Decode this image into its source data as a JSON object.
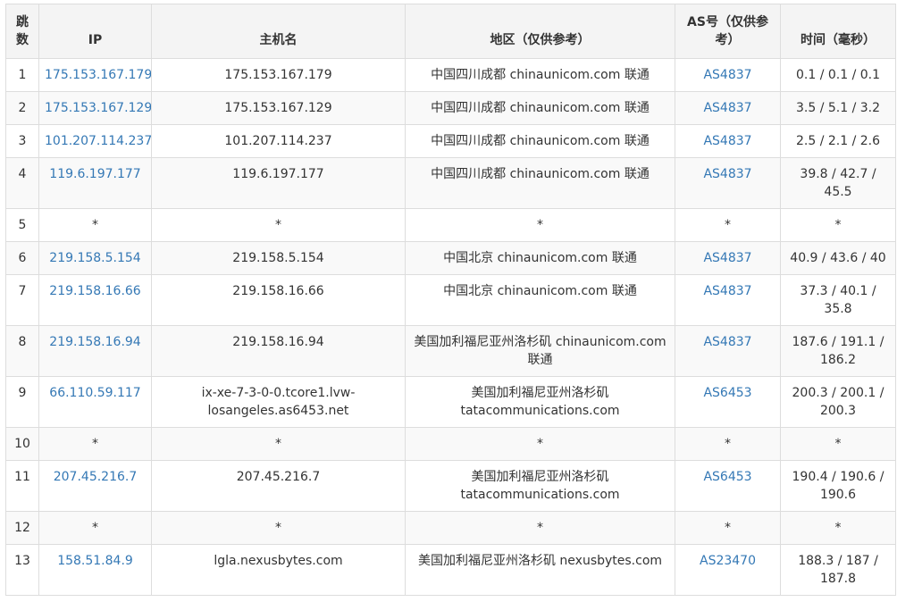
{
  "headers": [
    "跳数",
    "IP",
    "主机名",
    "地区（仅供参考）",
    "AS号（仅供参考）",
    "时间（毫秒）"
  ],
  "rows": [
    {
      "hop": "1",
      "ip": "175.153.167.179",
      "host": "175.153.167.179",
      "region": "中国四川成都 chinaunicom.com 联通",
      "asn": "AS4837",
      "time": "0.1 / 0.1 / 0.1"
    },
    {
      "hop": "2",
      "ip": "175.153.167.129",
      "host": "175.153.167.129",
      "region": "中国四川成都 chinaunicom.com 联通",
      "asn": "AS4837",
      "time": "3.5 / 5.1 / 3.2"
    },
    {
      "hop": "3",
      "ip": "101.207.114.237",
      "host": "101.207.114.237",
      "region": "中国四川成都 chinaunicom.com 联通",
      "asn": "AS4837",
      "time": "2.5 / 2.1 / 2.6"
    },
    {
      "hop": "4",
      "ip": "119.6.197.177",
      "host": "119.6.197.177",
      "region": "中国四川成都 chinaunicom.com 联通",
      "asn": "AS4837",
      "time": "39.8 / 42.7 / 45.5"
    },
    {
      "hop": "5",
      "ip": "*",
      "host": "*",
      "region": "*",
      "asn": "*",
      "time": "*"
    },
    {
      "hop": "6",
      "ip": "219.158.5.154",
      "host": "219.158.5.154",
      "region": "中国北京 chinaunicom.com 联通",
      "asn": "AS4837",
      "time": "40.9 / 43.6 / 40"
    },
    {
      "hop": "7",
      "ip": "219.158.16.66",
      "host": "219.158.16.66",
      "region": "中国北京 chinaunicom.com 联通",
      "asn": "AS4837",
      "time": "37.3 / 40.1 / 35.8"
    },
    {
      "hop": "8",
      "ip": "219.158.16.94",
      "host": "219.158.16.94",
      "region": "美国加利福尼亚州洛杉矶 chinaunicom.com 联通",
      "asn": "AS4837",
      "time": "187.6 / 191.1 / 186.2"
    },
    {
      "hop": "9",
      "ip": "66.110.59.117",
      "host": "ix-xe-7-3-0-0.tcore1.lvw-losangeles.as6453.net",
      "region": "美国加利福尼亚州洛杉矶 tatacommunications.com",
      "asn": "AS6453",
      "time": "200.3 / 200.1 / 200.3"
    },
    {
      "hop": "10",
      "ip": "*",
      "host": "*",
      "region": "*",
      "asn": "*",
      "time": "*"
    },
    {
      "hop": "11",
      "ip": "207.45.216.7",
      "host": "207.45.216.7",
      "region": "美国加利福尼亚州洛杉矶 tatacommunications.com",
      "asn": "AS6453",
      "time": "190.4 / 190.6 / 190.6"
    },
    {
      "hop": "12",
      "ip": "*",
      "host": "*",
      "region": "*",
      "asn": "*",
      "time": "*"
    },
    {
      "hop": "13",
      "ip": "158.51.84.9",
      "host": "lgla.nexusbytes.com",
      "region": "美国加利福尼亚州洛杉矶 nexusbytes.com",
      "asn": "AS23470",
      "time": "188.3 / 187 / 187.8"
    }
  ],
  "colors": {
    "link": "#3478b5",
    "header_bg": "#f4f4f4",
    "stripe": "#f9f9f9",
    "border": "#dddddd",
    "text": "#333333"
  }
}
